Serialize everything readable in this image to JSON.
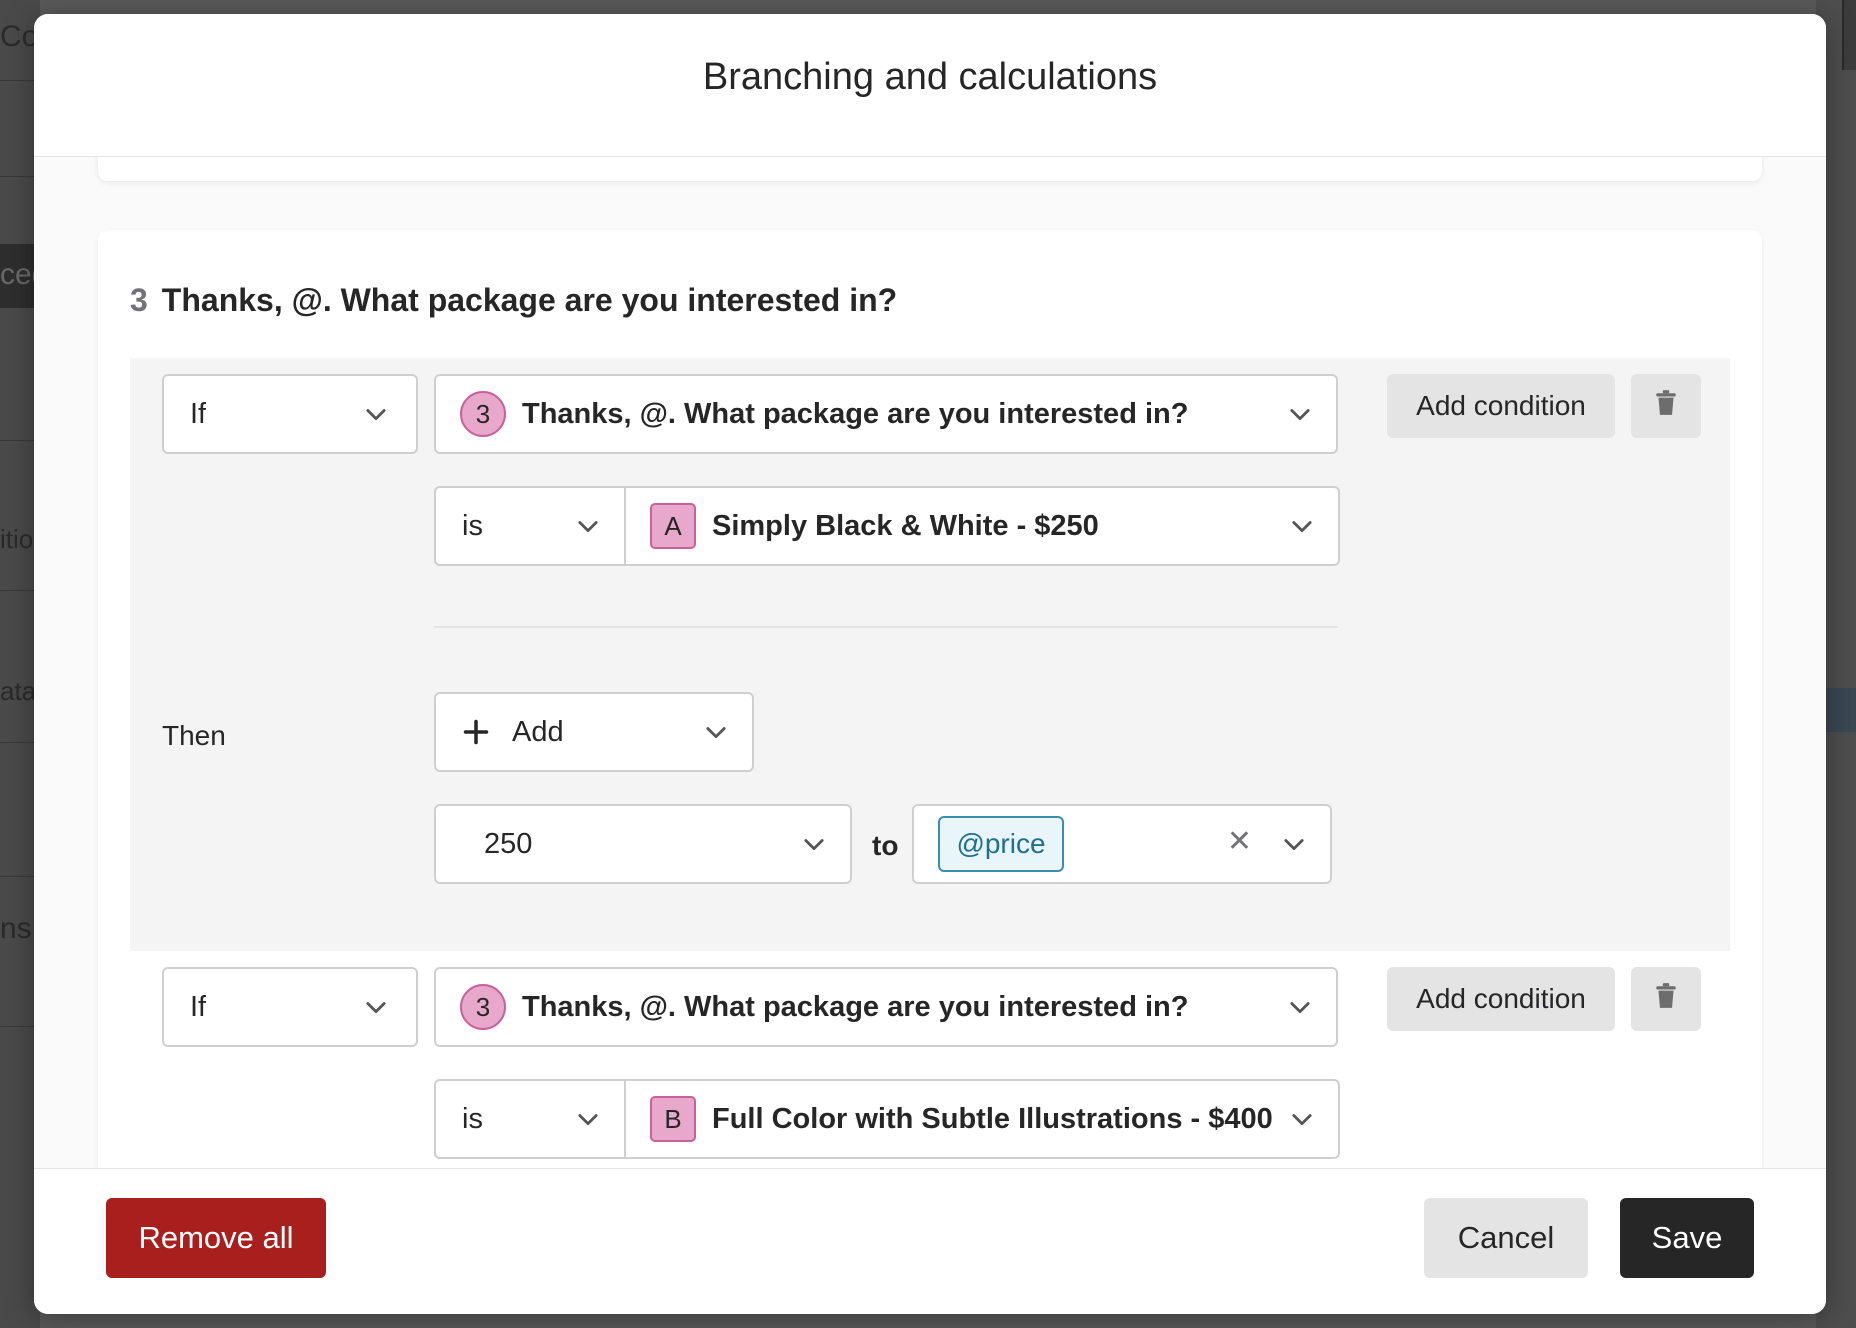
{
  "background": {
    "fragments": [
      "Co",
      "ced",
      "itio",
      "ata",
      "ns"
    ]
  },
  "modal": {
    "title": "Branching and calculations"
  },
  "question": {
    "number": "3",
    "text": "Thanks, @. What package are you interested in?"
  },
  "rules": [
    {
      "if_label": "If",
      "question_badge": "3",
      "question_text": "Thanks, @. What package are you interested in?",
      "operator": "is",
      "answer_badge": "A",
      "answer_text": "Simply Black & White - $250",
      "add_condition_label": "Add condition",
      "then_label": "Then",
      "action_label": "Add",
      "value": "250",
      "to_label": "to",
      "variable": "@price"
    },
    {
      "if_label": "If",
      "question_badge": "3",
      "question_text": "Thanks, @. What package are you interested in?",
      "operator": "is",
      "answer_badge": "B",
      "answer_text": "Full Color with Subtle Illustrations - $400",
      "add_condition_label": "Add condition"
    }
  ],
  "footer": {
    "remove_all_label": "Remove all",
    "cancel_label": "Cancel",
    "save_label": "Save"
  },
  "colors": {
    "badge_pink": "#e7a8cc",
    "remove_red": "#a91f1d",
    "save_dark": "#262627",
    "variable_blue": "#3a8fb0"
  },
  "icons": [
    "chevron-down-icon",
    "trash-icon",
    "plus-icon",
    "close-icon"
  ]
}
